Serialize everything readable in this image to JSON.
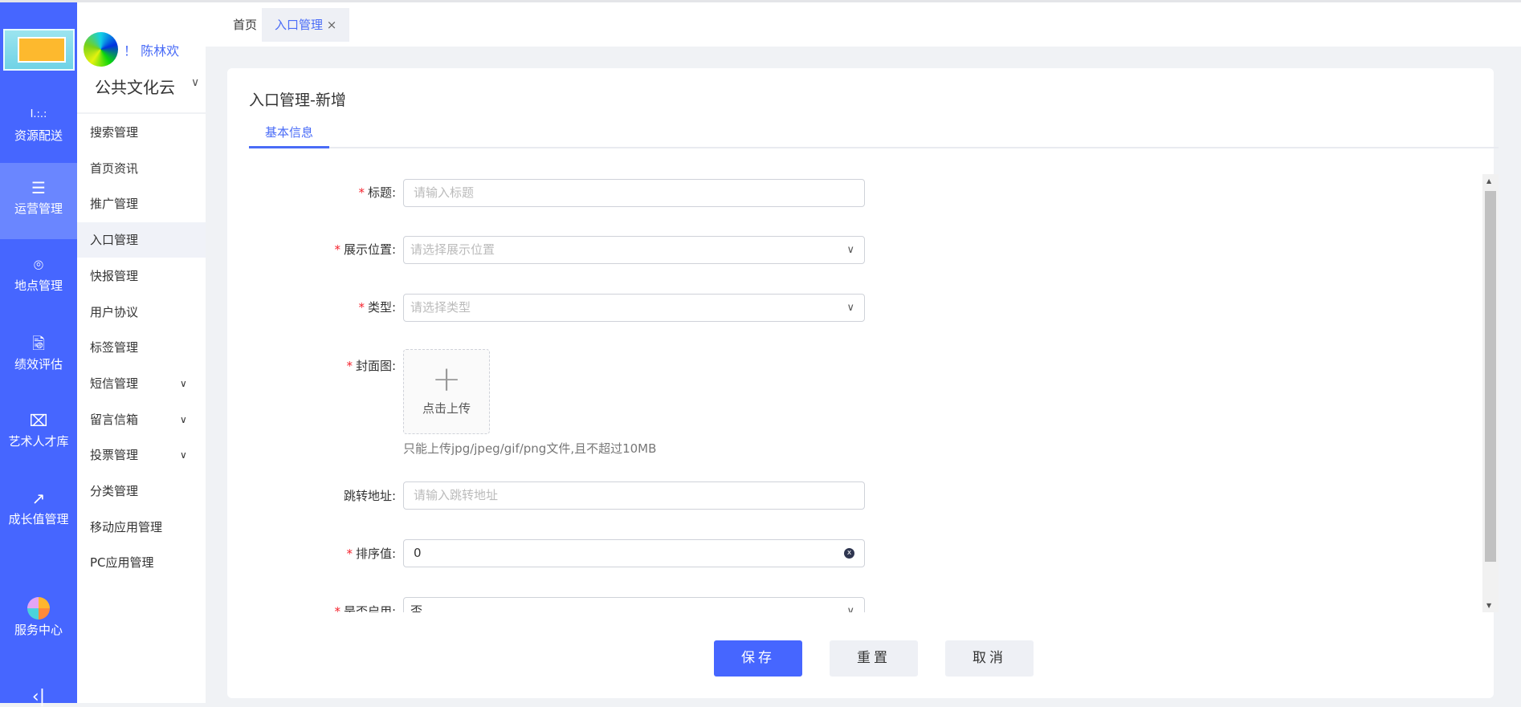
{
  "nav": {
    "items": [
      {
        "label": "资源配送",
        "icon": "dots-icon"
      },
      {
        "label": "运营管理",
        "icon": "list-icon",
        "active": true
      },
      {
        "label": "地点管理",
        "icon": "location-pin-icon"
      },
      {
        "label": "绩效评估",
        "icon": "report-search-icon"
      },
      {
        "label": "艺术人才库",
        "icon": "person-card-icon"
      },
      {
        "label": "成长值管理",
        "icon": "trend-up-icon"
      },
      {
        "label": "服务中心",
        "icon": "clover-icon"
      }
    ]
  },
  "user": {
    "name": "！ 陈林欢",
    "org": "公共文化云"
  },
  "menu": [
    {
      "label": "搜索管理"
    },
    {
      "label": "首页资讯"
    },
    {
      "label": "推广管理"
    },
    {
      "label": "入口管理",
      "active": true
    },
    {
      "label": "快报管理"
    },
    {
      "label": "用户协议"
    },
    {
      "label": "标签管理"
    },
    {
      "label": "短信管理",
      "expand": true
    },
    {
      "label": "留言信箱",
      "expand": true
    },
    {
      "label": "投票管理",
      "expand": true
    },
    {
      "label": "分类管理"
    },
    {
      "label": "移动应用管理"
    },
    {
      "label": "PC应用管理"
    }
  ],
  "tabs": [
    {
      "label": "首页"
    },
    {
      "label": "入口管理",
      "close": "×"
    }
  ],
  "page": {
    "title": "入口管理-新增",
    "form_tab": "基本信息"
  },
  "form": {
    "title": {
      "label": "标题:",
      "placeholder": "请输入标题"
    },
    "position": {
      "label": "展示位置:",
      "placeholder": "请选择展示位置"
    },
    "type": {
      "label": "类型:",
      "placeholder": "请选择类型"
    },
    "cover": {
      "label": "封面图:",
      "upload": "点击上传",
      "hint": "只能上传jpg/jpeg/gif/png文件,且不超过10MB"
    },
    "url": {
      "label": "跳转地址:",
      "placeholder": "请输入跳转地址"
    },
    "sort": {
      "label": "排序值:",
      "value": "0"
    },
    "enabled": {
      "label": "是否启用:",
      "value": "否"
    }
  },
  "buttons": {
    "save": "保存",
    "reset": "重置",
    "cancel": "取消"
  },
  "colors": {
    "accent": "#4666ff",
    "required": "#f5222d"
  }
}
